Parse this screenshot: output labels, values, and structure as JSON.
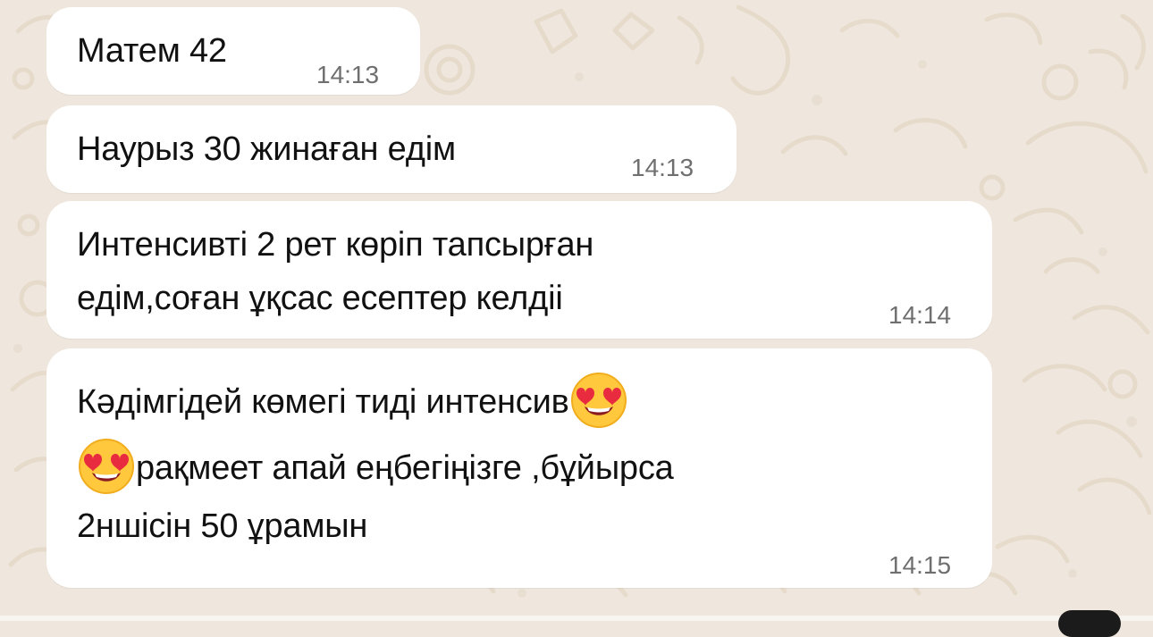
{
  "chat": {
    "messages": [
      {
        "text": "Матем 42",
        "time": "14:13"
      },
      {
        "text": "Наурыз 30 жинаған едім",
        "time": "14:13"
      },
      {
        "lines": [
          "Интенсивті 2 рет көріп тапсырған",
          "едім,соған ұқсас есептер келдіі"
        ],
        "time": "14:14"
      },
      {
        "line1": "Кәдімгідей көмегі тиді интенсив",
        "line2": "рақмеет апай еңбегіңізге ,бұйырса",
        "line3": "2ншісін 50 ұрамын",
        "time": "14:15"
      }
    ]
  },
  "style": {
    "background": "#efe7dd",
    "bubble": "#ffffff",
    "text": "#111111",
    "time": "#6f6f6f",
    "emoji": "smiling-face-with-heart-eyes-icon"
  }
}
